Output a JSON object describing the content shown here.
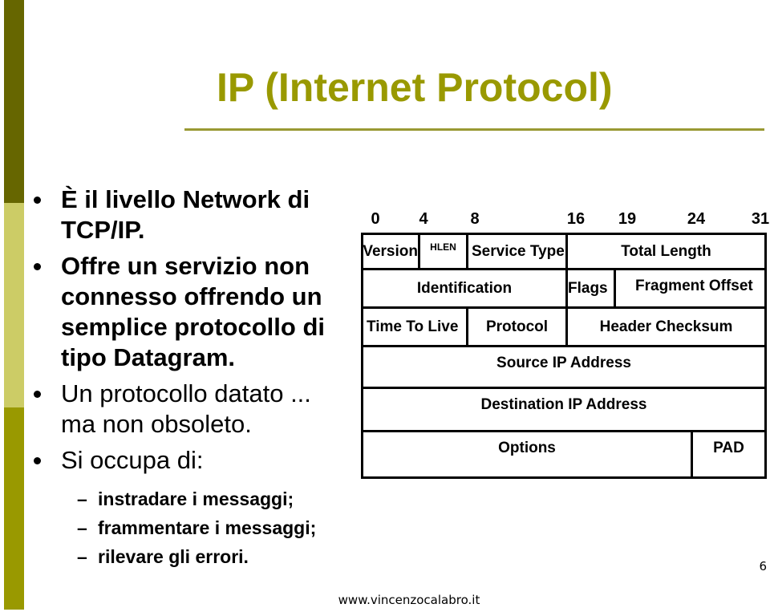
{
  "slide": {
    "title": "IP (Internet Protocol)",
    "page_number": "6",
    "footer": "www.vincenzocalabro.it",
    "colors": {
      "title": "#999900",
      "bar_top": "#666600",
      "bar_mid": "#cccc66",
      "bar_bottom": "#999900",
      "rule": "#999933"
    }
  },
  "bullets": [
    {
      "lines": [
        "È il livello Network di",
        "TCP/IP."
      ]
    },
    {
      "lines": [
        "Offre un servizio non",
        "connesso offrendo un",
        "semplice protocollo di",
        "tipo Datagram."
      ]
    },
    {
      "lines": [
        "Un protocollo datato ...",
        "ma non obsoleto."
      ]
    },
    {
      "lines": [
        "Si occupa di:"
      ]
    }
  ],
  "sub_bullets": [
    {
      "dash": "–",
      "text": "instradare i messaggi;"
    },
    {
      "dash": "–",
      "text": "frammentare i messaggi;"
    },
    {
      "dash": "–",
      "text": "rilevare gli errori."
    }
  ],
  "diagram": {
    "bit_ticks": [
      "0",
      "4",
      "8",
      "16",
      "19",
      "24",
      "31"
    ],
    "rows": [
      [
        {
          "label": "Version",
          "bits": [
            0,
            4
          ]
        },
        {
          "label": "HLEN",
          "bits": [
            4,
            8
          ]
        },
        {
          "label": "Service Type",
          "bits": [
            8,
            16
          ]
        },
        {
          "label": "Total Length",
          "bits": [
            16,
            32
          ]
        }
      ],
      [
        {
          "label": "Identification",
          "bits": [
            0,
            16
          ]
        },
        {
          "label": "Flags",
          "bits": [
            16,
            19
          ]
        },
        {
          "label": "Fragment Offset",
          "bits": [
            19,
            32
          ]
        }
      ],
      [
        {
          "label": "Time To Live",
          "bits": [
            0,
            8
          ]
        },
        {
          "label": "Protocol",
          "bits": [
            8,
            16
          ]
        },
        {
          "label": "Header Checksum",
          "bits": [
            16,
            32
          ]
        }
      ],
      [
        {
          "label": "Source IP Address",
          "bits": [
            0,
            32
          ]
        }
      ],
      [
        {
          "label": "Destination IP Address",
          "bits": [
            0,
            32
          ]
        }
      ],
      [
        {
          "label": "Options",
          "bits": [
            0,
            26
          ]
        },
        {
          "label": "PAD",
          "bits": [
            26,
            32
          ]
        }
      ]
    ]
  }
}
